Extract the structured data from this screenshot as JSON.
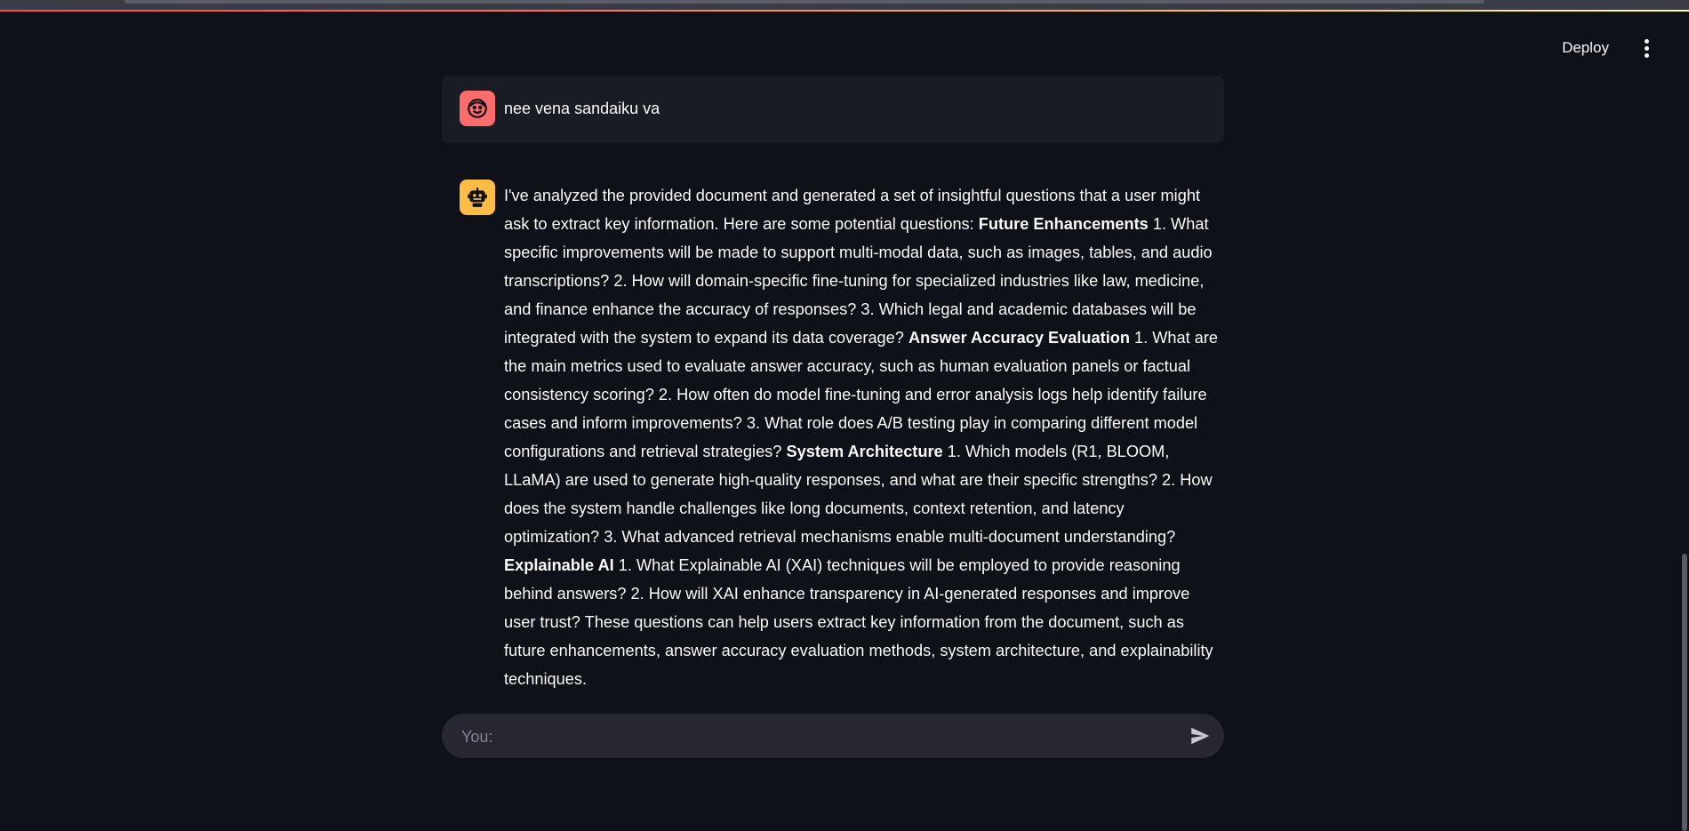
{
  "header": {
    "deploy_label": "Deploy",
    "menu_icon": "more-vert-icon"
  },
  "colors": {
    "background": "#0e1117",
    "user_avatar": "#ff6c6c",
    "bot_avatar": "#ffbd45",
    "input_bg": "#262730"
  },
  "messages": [
    {
      "role": "user",
      "avatar_icon": "user-face-icon",
      "text": "nee vena sandaiku va"
    },
    {
      "role": "assistant",
      "avatar_icon": "robot-icon",
      "segments": [
        {
          "bold": false,
          "text": "I've analyzed the provided document and generated a set of insightful questions that a user might ask to extract key information. Here are some potential questions: "
        },
        {
          "bold": true,
          "text": "Future Enhancements"
        },
        {
          "bold": false,
          "text": " 1. What specific improvements will be made to support multi-modal data, such as images, tables, and audio transcriptions? 2. How will domain-specific fine-tuning for specialized industries like law, medicine, and finance enhance the accuracy of responses? 3. Which legal and academic databases will be integrated with the system to expand its data coverage? "
        },
        {
          "bold": true,
          "text": "Answer Accuracy Evaluation"
        },
        {
          "bold": false,
          "text": " 1. What are the main metrics used to evaluate answer accuracy, such as human evaluation panels or factual consistency scoring? 2. How often do model fine-tuning and error analysis logs help identify failure cases and inform improvements? 3. What role does A/B testing play in comparing different model configurations and retrieval strategies? "
        },
        {
          "bold": true,
          "text": "System Architecture"
        },
        {
          "bold": false,
          "text": " 1. Which models (R1, BLOOM, LLaMA) are used to generate high-quality responses, and what are their specific strengths? 2. How does the system handle challenges like long documents, context retention, and latency optimization? 3. What advanced retrieval mechanisms enable multi-document understanding? "
        },
        {
          "bold": true,
          "text": "Explainable AI"
        },
        {
          "bold": false,
          "text": " 1. What Explainable AI (XAI) techniques will be employed to provide reasoning behind answers? 2. How will XAI enhance transparency in AI-generated responses and improve user trust? These questions can help users extract key information from the document, such as future enhancements, answer accuracy evaluation methods, system architecture, and explainability techniques."
        }
      ]
    }
  ],
  "chat_input": {
    "placeholder": "You:",
    "value": "",
    "send_icon": "send-icon"
  }
}
